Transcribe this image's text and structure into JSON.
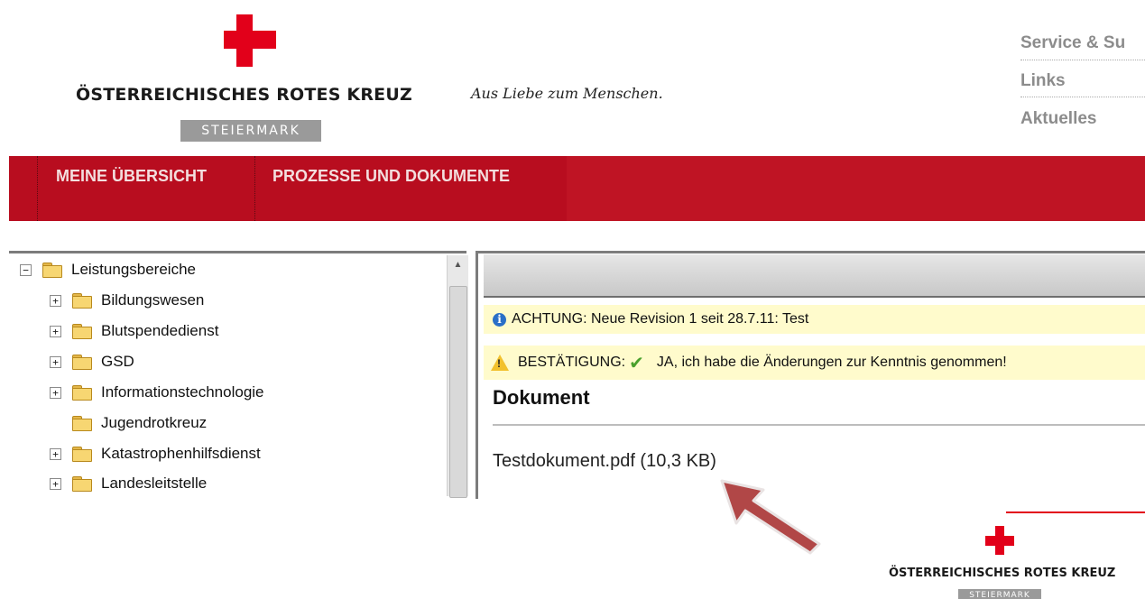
{
  "header": {
    "org_name": "ÖSTERREICHISCHES ROTES KREUZ",
    "region": "STEIERMARK",
    "slogan": "Aus Liebe zum Menschen.",
    "links": [
      "Service & Su",
      "Links",
      "Aktuelles"
    ],
    "brand_color": "#e2001a"
  },
  "nav": {
    "items": [
      "MEINE ÜBERSICHT",
      "PROZESSE UND DOKUMENTE"
    ],
    "color": "#b80d1f"
  },
  "tree": {
    "root": {
      "label": "Leistungsbereiche",
      "toggle": "−"
    },
    "items": [
      {
        "label": "Bildungswesen",
        "toggle": "+"
      },
      {
        "label": "Blutspendedienst",
        "toggle": "+"
      },
      {
        "label": "GSD",
        "toggle": "+"
      },
      {
        "label": "Informationstechnologie",
        "toggle": "+"
      },
      {
        "label": "Jugendrotkreuz",
        "toggle": ""
      },
      {
        "label": "Katastrophenhilfsdienst",
        "toggle": "+"
      },
      {
        "label": "Landesleitstelle",
        "toggle": "+"
      }
    ]
  },
  "content": {
    "notice_info": "ACHTUNG: Neue Revision 1 seit 28.7.11: Test",
    "confirm_label": "BESTÄTIGUNG:",
    "confirm_text": "JA, ich habe die Änderungen zur Kenntnis genommen!",
    "section_title": "Dokument",
    "document_link": "Testdokument.pdf (10,3 KB)"
  },
  "footer": {
    "org_name": "ÖSTERREICHISCHES ROTES KREUZ",
    "region": "STEIERMARK"
  },
  "icons": [
    "red-cross-icon",
    "minus-toggle-icon",
    "plus-toggle-icon",
    "folder-icon",
    "info-icon",
    "warning-icon",
    "checkmark-icon",
    "arrow-pointer-icon"
  ]
}
